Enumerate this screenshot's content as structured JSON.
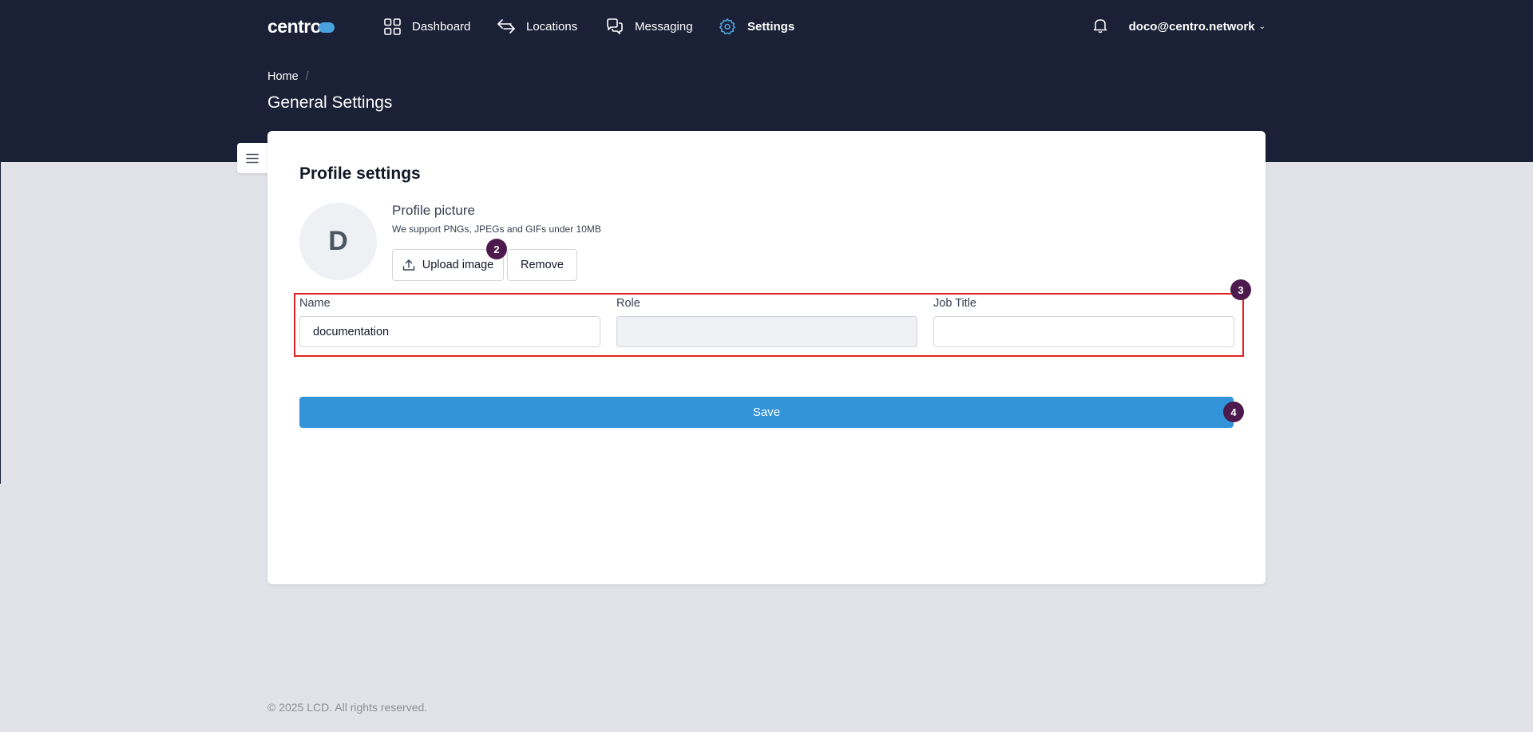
{
  "brand": {
    "logo_text": "centro",
    "accent": "#4aa3df",
    "header_bg": "#1a2035"
  },
  "nav": {
    "items": [
      {
        "label": "Dashboard",
        "icon": "grid-icon"
      },
      {
        "label": "Locations",
        "icon": "arrows-icon"
      },
      {
        "label": "Messaging",
        "icon": "chat-bubbles-icon"
      },
      {
        "label": "Settings",
        "icon": "gear-icon",
        "active": true
      }
    ],
    "notifications_icon": "bell-icon",
    "user_email": "doco@centro.network"
  },
  "breadcrumb": {
    "home": "Home",
    "separator": "/"
  },
  "page_title": "General Settings",
  "profile": {
    "section_title": "Profile settings",
    "avatar_initial": "D",
    "picture_title": "Profile picture",
    "picture_hint": "We support PNGs, JPEGs and GIFs under 10MB",
    "upload_label": "Upload image",
    "remove_label": "Remove",
    "fields": {
      "name": {
        "label": "Name",
        "value": "documentation"
      },
      "role": {
        "label": "Role",
        "value": ""
      },
      "job_title": {
        "label": "Job Title",
        "value": ""
      }
    },
    "save_label": "Save"
  },
  "annotations": {
    "marker_2": "2",
    "marker_3": "3",
    "marker_4": "4",
    "marker_color": "#4c1a4d",
    "highlight_color": "#e02424"
  },
  "footer": {
    "copyright": "© 2025 LCD. All rights reserved."
  }
}
